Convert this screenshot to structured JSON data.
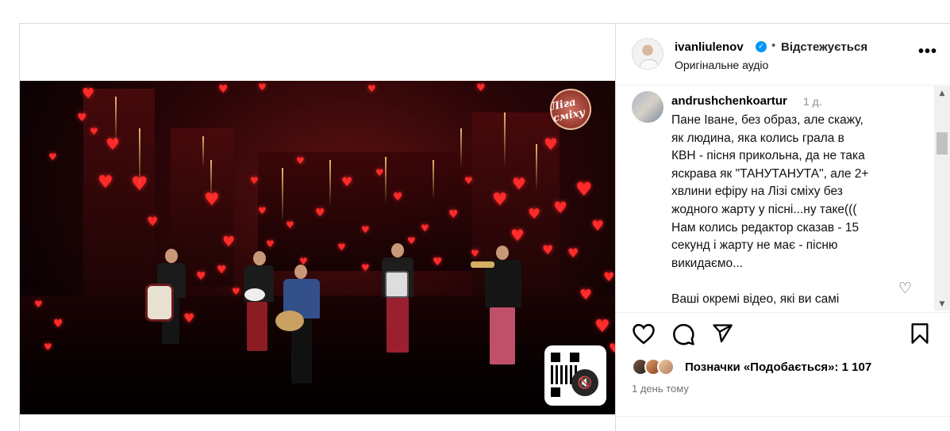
{
  "post": {
    "media": {
      "logo_text": "Ліга сміху",
      "mute_icon": "muted-speaker-icon",
      "qr_icon": "qr-code-icon"
    },
    "header": {
      "username": "ivanliulenov",
      "verified_icon": "verified-badge-icon",
      "separator": "•",
      "follow_status": "Відстежується",
      "audio_label": "Оригінальне аудіо",
      "more_icon": "more-options-icon"
    },
    "comment": {
      "username": "andrushchenkoartur",
      "time": "1 д.",
      "text_lines": [
        "Пане Іване, без образ, але скажу,",
        "як людина, яка колись грала в",
        "КВН - пісня прикольна, да не така",
        "яскрава як \"ТАНУТАНУТА\", але 2+",
        "хвлини ефіру на Лізі сміху без",
        "жодного жарту у пісні...ну таке(((",
        "Нам колись редактор сказав - 15",
        "секунд і жарту не має - пісню",
        "викидаємо...",
        "",
        "Ваші окремі відео, які ви самі"
      ],
      "like_icon": "heart-outline-icon"
    },
    "actions": {
      "like_icon": "heart-icon",
      "comment_icon": "comment-icon",
      "share_icon": "paper-plane-icon",
      "save_icon": "bookmark-icon"
    },
    "likes": {
      "label": "Позначки «Подобається»: 1 107"
    },
    "posted": "1 день тому",
    "colors": {
      "accent_verified": "#0095f6",
      "muted_text": "#8e8e8e",
      "border": "#dbdbdb"
    }
  }
}
